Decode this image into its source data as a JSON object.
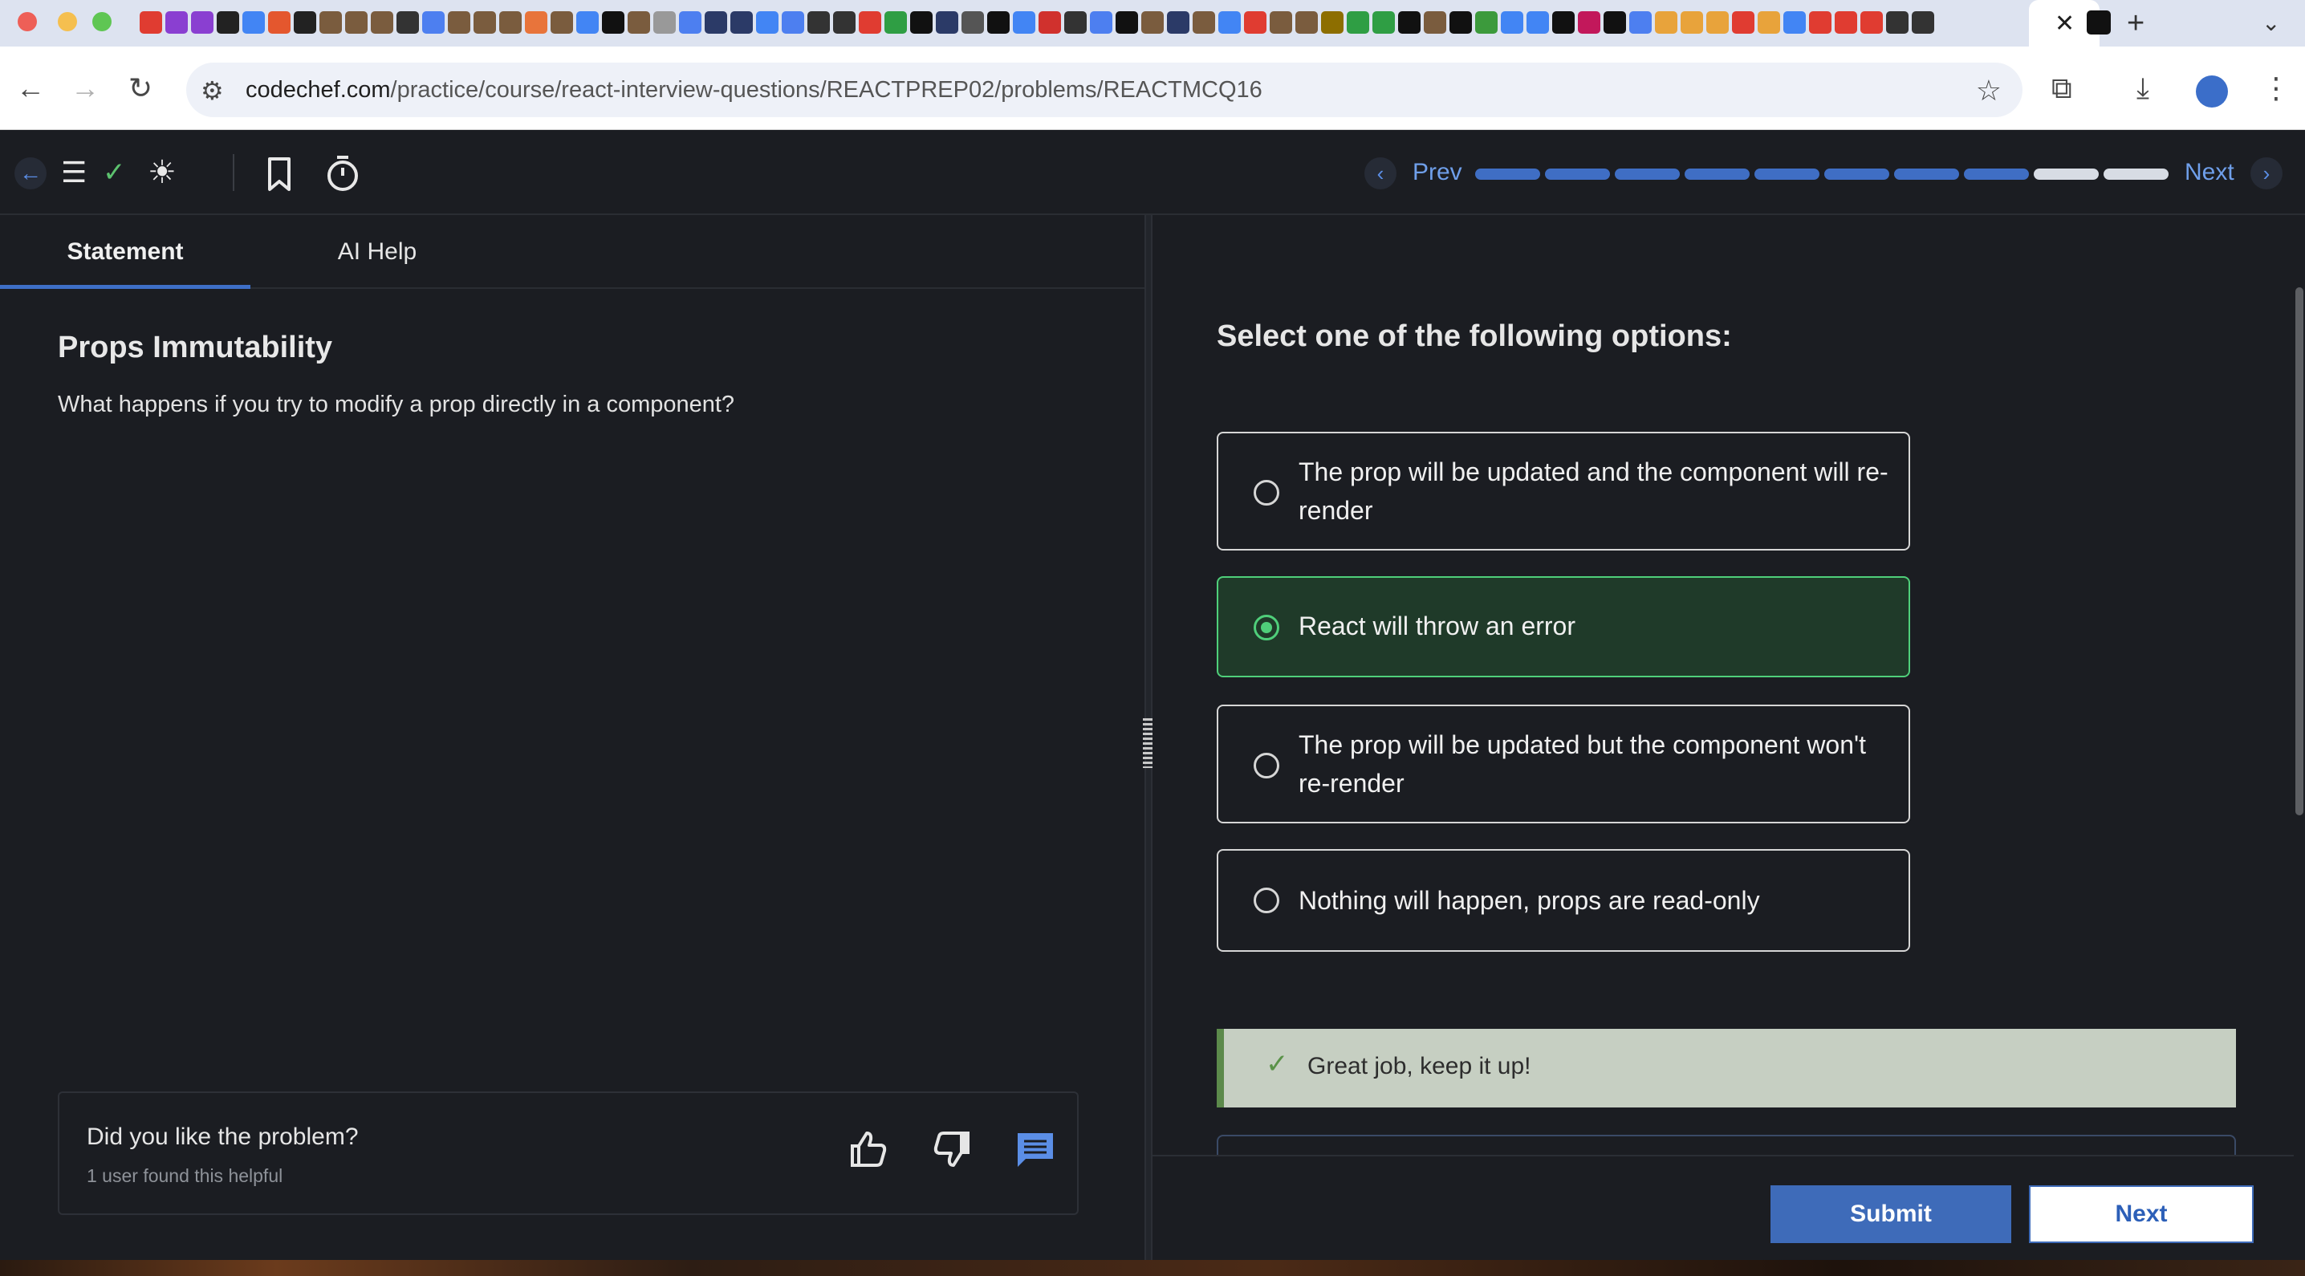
{
  "browser": {
    "url_host": "codechef.com",
    "url_path": "/practice/course/react-interview-questions/REACTPREP02/problems/REACTMCQ16",
    "active_tab_close": "✕",
    "new_tab": "+",
    "tab_menu": "⌄"
  },
  "header": {
    "prev_label": "Prev",
    "next_label": "Next",
    "progress_total": 10,
    "progress_done": 8
  },
  "tabs": [
    {
      "label": "Statement",
      "active": true
    },
    {
      "label": "AI Help",
      "active": false
    }
  ],
  "problem": {
    "title": "Props Immutability",
    "question": "What happens if you try to modify a prop directly in a component?"
  },
  "feedback": {
    "question": "Did you like the problem?",
    "helpful_count": "1 user found this helpful"
  },
  "answer_panel": {
    "prompt": "Select one of the following options:",
    "options": [
      {
        "text": "The prop will be updated and the component will re-render",
        "selected": false
      },
      {
        "text": "React will throw an error",
        "selected": true
      },
      {
        "text": "The prop will be updated but the component won't re-render",
        "selected": false
      },
      {
        "text": "Nothing will happen, props are read-only",
        "selected": false
      }
    ],
    "result_message": "Great job, keep it up!"
  },
  "actions": {
    "submit_label": "Submit",
    "next_label": "Next"
  },
  "colors": {
    "accent": "#3e6bb9",
    "selected_border": "#4fcf7a",
    "selected_bg": "#1f3a29",
    "success_bg": "#c6cfc2"
  },
  "icons": [
    "back-arrow-icon",
    "list-icon",
    "check-icon",
    "sun-icon",
    "bookmark-icon",
    "timer-icon",
    "thumbs-up-icon",
    "thumbs-down-icon",
    "comment-icon"
  ]
}
